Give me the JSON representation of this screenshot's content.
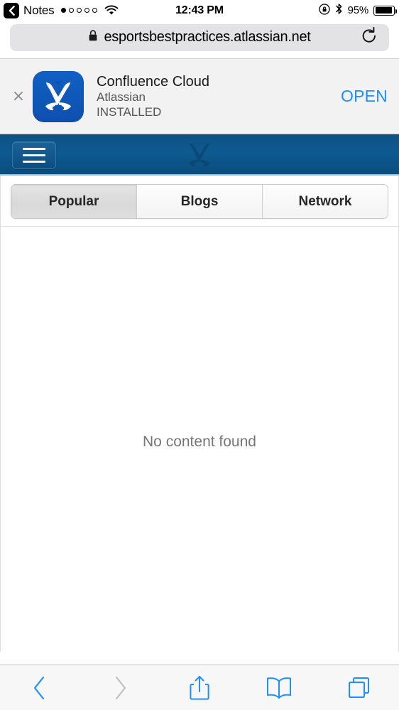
{
  "status_bar": {
    "back_app_label": "Notes",
    "back_icon": "chevron-left-icon",
    "signal_dots_total": 5,
    "signal_dots_filled": 1,
    "wifi_icon": "wifi-icon",
    "time": "12:43 PM",
    "rotation_lock_icon": "rotation-lock-icon",
    "bluetooth_icon": "bluetooth-icon",
    "battery_percent": "95%",
    "battery_level": 95
  },
  "browser": {
    "url": "esportsbestpractices.atlassian.net",
    "secure_icon": "lock-icon",
    "reload_icon": "reload-icon"
  },
  "app_banner": {
    "close_label": "×",
    "icon_name": "confluence-app-icon",
    "title": "Confluence Cloud",
    "developer": "Atlassian",
    "state": "INSTALLED",
    "action_label": "OPEN",
    "action_color": "#1e8fff",
    "icon_bg_color": "#0d52b3"
  },
  "site_header": {
    "menu_icon": "hamburger-menu-icon",
    "logo_name": "esports-x-logo",
    "bg_color": "#0d5383"
  },
  "tabs": [
    {
      "label": "Popular",
      "active": true
    },
    {
      "label": "Blogs",
      "active": false
    },
    {
      "label": "Network",
      "active": false
    }
  ],
  "content": {
    "empty_message": "No content found"
  },
  "toolbar": {
    "back_icon": "chevron-left-icon",
    "forward_icon": "chevron-right-icon",
    "share_icon": "share-icon",
    "bookmarks_icon": "book-icon",
    "tabs_icon": "tabs-icon",
    "back_enabled": true,
    "forward_enabled": false
  }
}
